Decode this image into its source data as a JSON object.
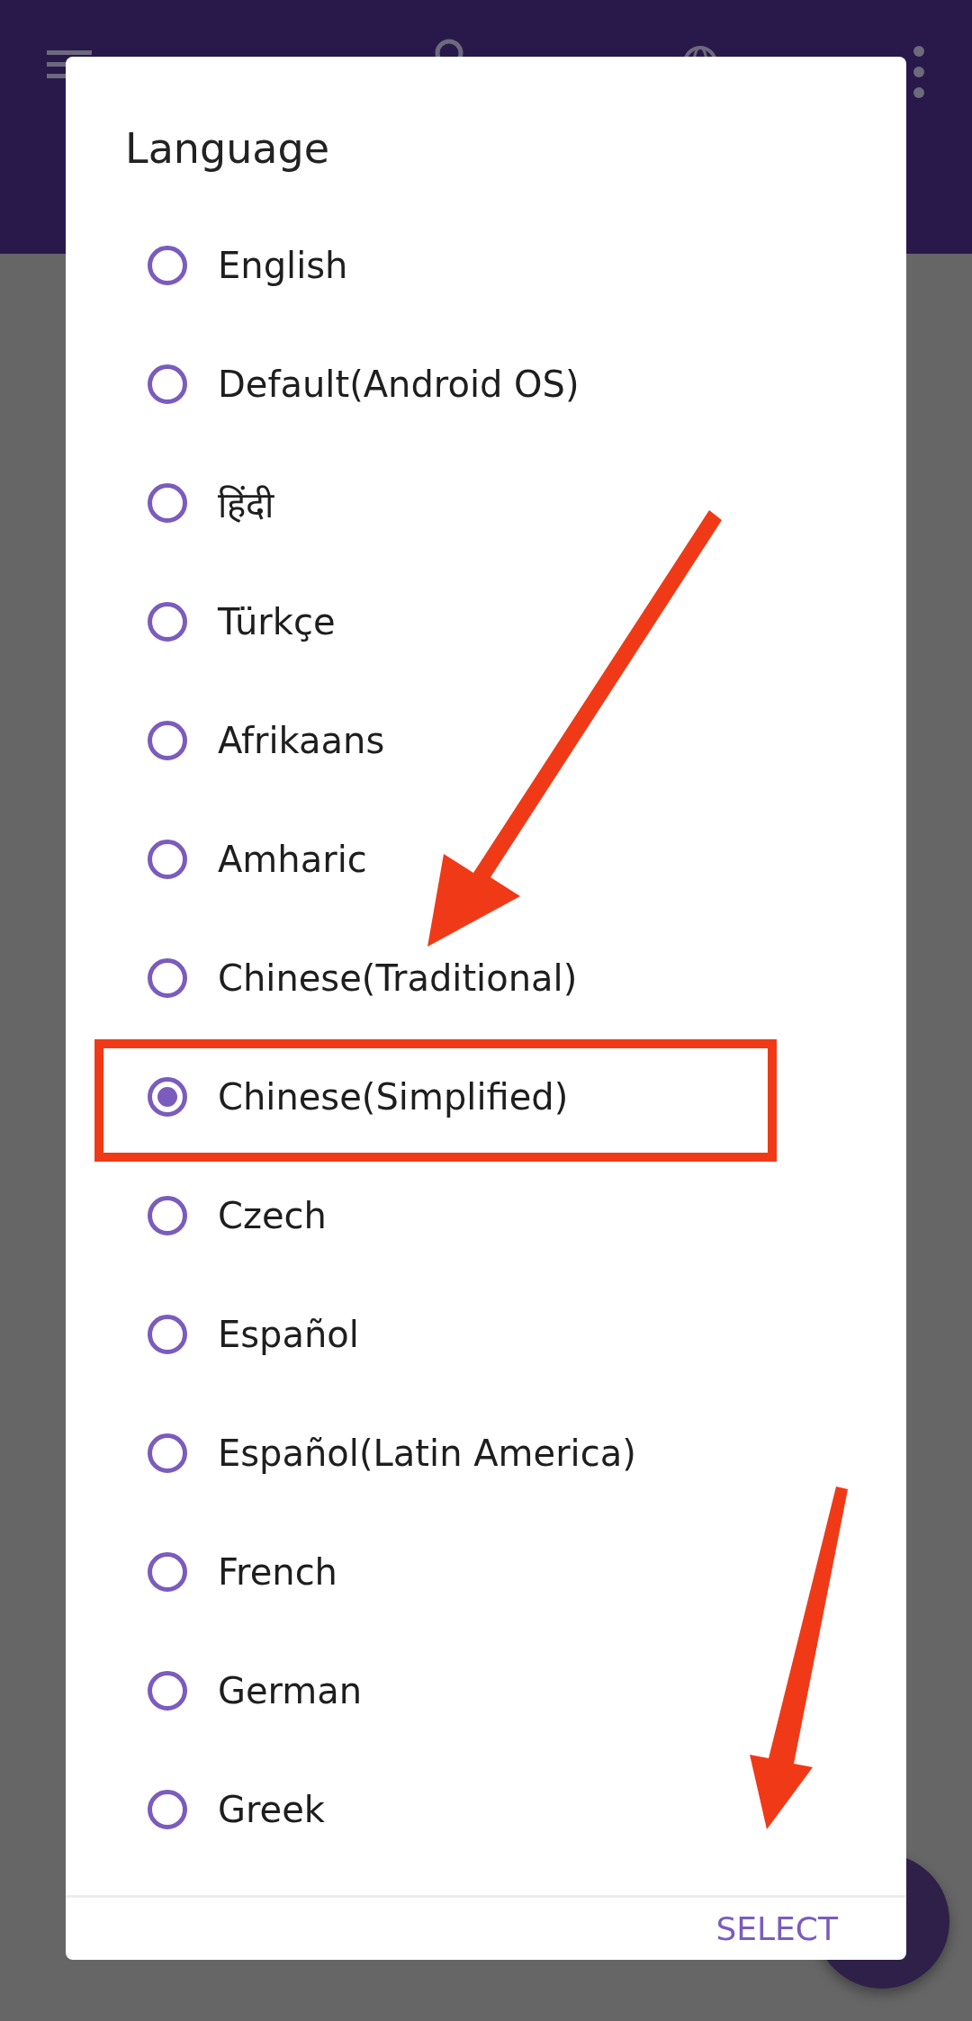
{
  "dialog": {
    "title": "Language",
    "options": [
      {
        "label": "English",
        "selected": false
      },
      {
        "label": "Default(Android OS)",
        "selected": false
      },
      {
        "label": "हिंदी",
        "selected": false
      },
      {
        "label": "Türkçe",
        "selected": false
      },
      {
        "label": "Afrikaans",
        "selected": false
      },
      {
        "label": "Amharic",
        "selected": false
      },
      {
        "label": "Chinese(Traditional)",
        "selected": false
      },
      {
        "label": "Chinese(Simplified)",
        "selected": true
      },
      {
        "label": "Czech",
        "selected": false
      },
      {
        "label": "Español",
        "selected": false
      },
      {
        "label": "Español(Latin America)",
        "selected": false
      },
      {
        "label": "French",
        "selected": false
      },
      {
        "label": "German",
        "selected": false
      },
      {
        "label": "Greek",
        "selected": false
      }
    ],
    "button": "SELECT"
  }
}
